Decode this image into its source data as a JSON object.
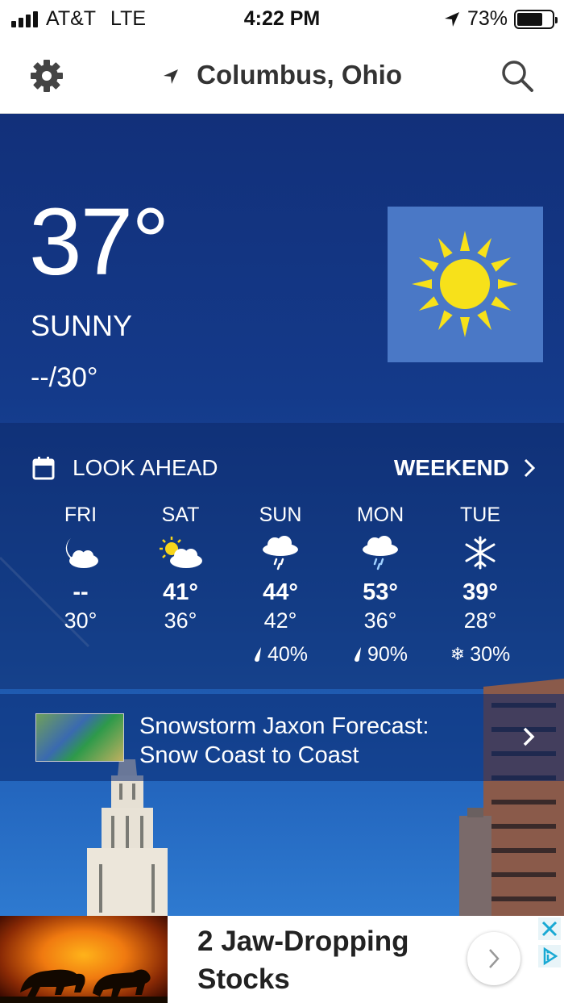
{
  "status": {
    "carrier": "AT&T",
    "network": "LTE",
    "time": "4:22 PM",
    "battery": "73%",
    "battery_fraction": 0.73
  },
  "header": {
    "location": "Columbus, Ohio"
  },
  "current": {
    "temperature": "37°",
    "condition": "SUNNY",
    "hi_lo": "--/30°",
    "icon": "sun-icon"
  },
  "lookahead": {
    "title": "LOOK AHEAD",
    "link": "WEEKEND",
    "days": [
      {
        "name": "FRI",
        "icon": "moon-cloud-icon",
        "high": "--",
        "low": "30°",
        "precip": ""
      },
      {
        "name": "SAT",
        "icon": "partly-sunny-icon",
        "high": "41°",
        "low": "36°",
        "precip": ""
      },
      {
        "name": "SUN",
        "icon": "rain-icon",
        "high": "44°",
        "low": "42°",
        "precip": "40%",
        "precip_icon": "raindrop-icon"
      },
      {
        "name": "MON",
        "icon": "rain-icon",
        "high": "53°",
        "low": "36°",
        "precip": "90%",
        "precip_icon": "raindrop-icon"
      },
      {
        "name": "TUE",
        "icon": "snowflake-icon",
        "high": "39°",
        "low": "28°",
        "precip": "30%",
        "precip_icon": "snowflake-icon"
      }
    ]
  },
  "news": {
    "line1": "Snowstorm Jaxon Forecast:",
    "line2": "Snow Coast to Coast"
  },
  "ad": {
    "line1": "2 Jaw-Dropping",
    "line2": "Stocks"
  },
  "colors": {
    "accent_blue": "#143a8a",
    "sun_box": "#4a78c6",
    "sun": "#f7e11a"
  }
}
